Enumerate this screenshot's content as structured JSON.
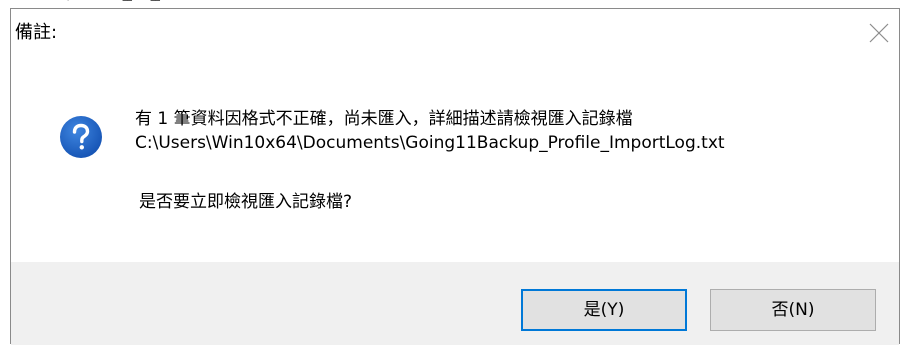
{
  "background_window": {
    "glyphs": [
      "╵",
      "└┘",
      "└┘"
    ]
  },
  "dialog": {
    "title": "備註:",
    "close_icon": "close-icon",
    "icon": "question-icon",
    "icon_color": "#1c5fbd",
    "message_line1": "有 1 筆資料因格式不正確，尚未匯入，詳細描述請檢視匯入記錄檔",
    "message_line2": "C:\\Users\\Win10x64\\Documents\\Going11Backup_Profile_ImportLog.txt",
    "question": "是否要立即檢視匯入記錄檔?",
    "buttons": {
      "yes_label": "是(Y)",
      "no_label": "否(N)"
    }
  },
  "colors": {
    "footer_bg": "#f0f0f0",
    "default_button_border": "#0078d7",
    "button_bg": "#e1e1e1"
  }
}
